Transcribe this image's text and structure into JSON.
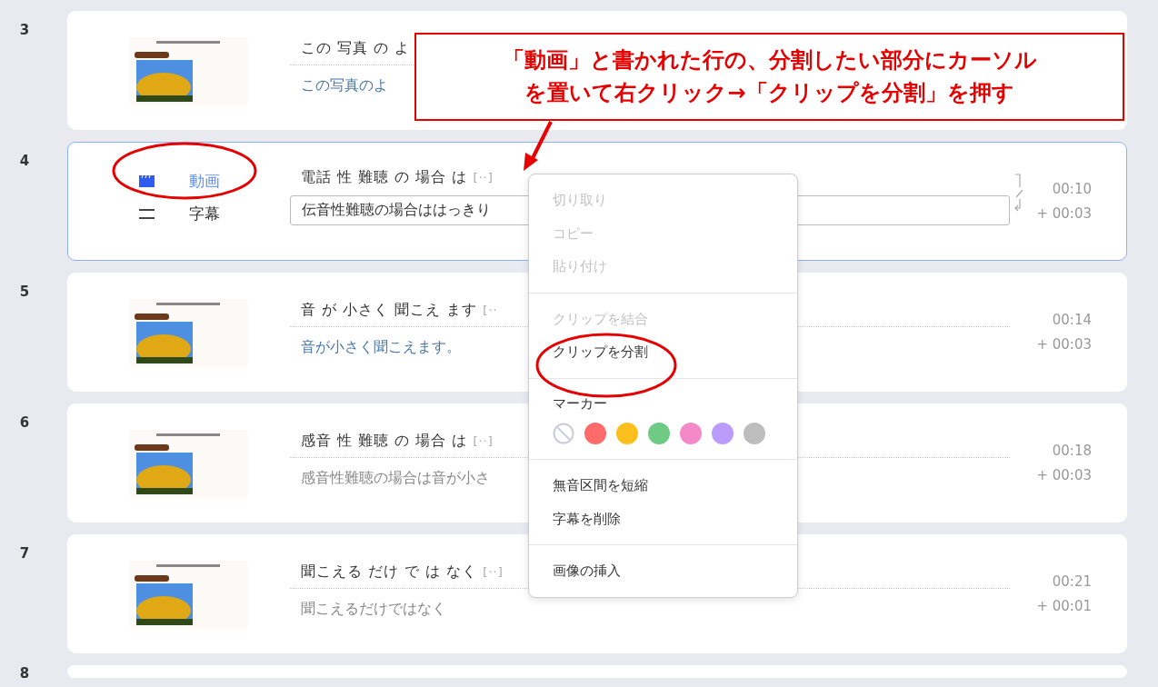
{
  "clips": [
    {
      "number": "3",
      "kind": "image",
      "selected": false,
      "words": "この 写真 の よ",
      "subtitle": "この写真のよ",
      "subtitle_accent": true
    },
    {
      "number": "4",
      "kind": "editing",
      "selected": true,
      "words": "電話 性 難聴 の 場合 は",
      "more": "[··]",
      "tracks": [
        {
          "label": "動画",
          "kind": "video",
          "selected": true
        },
        {
          "label": "字幕",
          "kind": "subtitle",
          "selected": false
        }
      ],
      "input_value": "伝音性難聴の場合ははっきり",
      "merged": true,
      "start": "00:10",
      "duration": "+ 00:03"
    },
    {
      "number": "5",
      "kind": "image",
      "selected": false,
      "words": "音 が 小さく 聞こえ ます",
      "more": "[··",
      "subtitle": "音が小さく聞こえます。",
      "subtitle_accent": true,
      "start": "00:14",
      "duration": "+ 00:03"
    },
    {
      "number": "6",
      "kind": "image",
      "selected": false,
      "words": "感音 性 難聴 の 場合 は",
      "more": "[··]",
      "subtitle": "感音性難聴の場合は音が小さ",
      "subtitle_accent": false,
      "start": "00:18",
      "duration": "+ 00:03"
    },
    {
      "number": "7",
      "kind": "image",
      "selected": false,
      "words": "聞こえる だけ で は なく",
      "more": "[··]",
      "subtitle": "聞こえるだけではなく",
      "subtitle_accent": false,
      "start": "00:21",
      "duration": "+ 00:01"
    },
    {
      "number": "8",
      "kind": "partial",
      "selected": false
    }
  ],
  "context_menu": {
    "groups": [
      {
        "items": [
          {
            "label": "切り取り",
            "disabled": true
          },
          {
            "label": "コピー",
            "disabled": true
          },
          {
            "label": "貼り付け",
            "disabled": true
          }
        ]
      },
      {
        "items": [
          {
            "label": "クリップを結合",
            "disabled": true
          },
          {
            "label": "クリップを分割",
            "disabled": false
          }
        ]
      },
      {
        "title": "マーカー",
        "markers": [
          {
            "kind": "none"
          },
          {
            "kind": "color",
            "color": "#ff6b6b"
          },
          {
            "kind": "color",
            "color": "#fcbf1e"
          },
          {
            "kind": "color",
            "color": "#6fcb83"
          },
          {
            "kind": "color",
            "color": "#f589c8"
          },
          {
            "kind": "color",
            "color": "#bb9bfb"
          },
          {
            "kind": "color",
            "color": "#bdbdbd"
          }
        ]
      },
      {
        "items": [
          {
            "label": "無音区間を短縮",
            "disabled": false
          },
          {
            "label": "字幕を削除",
            "disabled": false
          }
        ]
      },
      {
        "items": [
          {
            "label": "画像の挿入",
            "disabled": false
          }
        ]
      }
    ]
  },
  "annotation": {
    "lines": [
      "「動画」と書かれた行の、分割したい部分にカーソル",
      "を置いて右クリック→「クリップを分割」を押す"
    ]
  }
}
